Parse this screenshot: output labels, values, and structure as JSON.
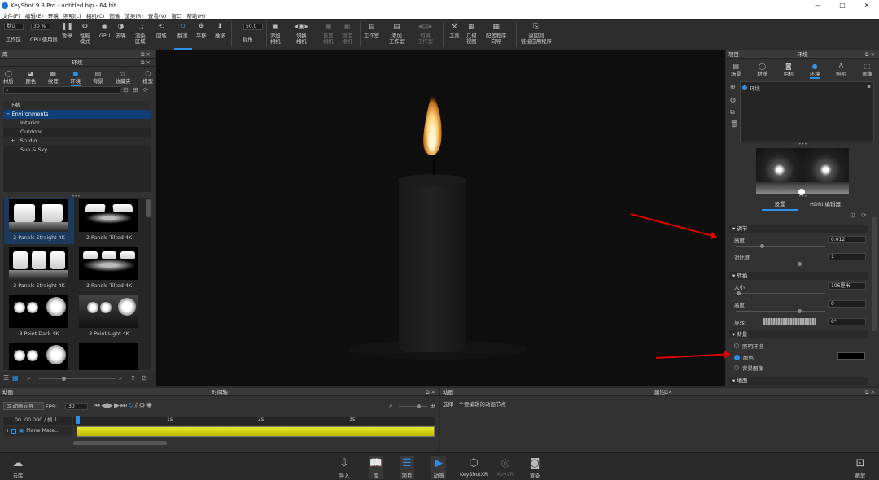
{
  "window": {
    "title": "KeyShot 9.3 Pro  -  untitled.bip  -  64 bit",
    "min": "—",
    "max": "□",
    "close": "✕"
  },
  "menu": [
    "文件(F)",
    "编辑(E)",
    "环境",
    "照明(L)",
    "相机(C)",
    "图像",
    "渲染(R)",
    "查看(V)",
    "窗口",
    "帮助(H)"
  ],
  "toolbar": {
    "workspace_select": "默认",
    "cpu_value": "30 %",
    "workspace": "工作区",
    "cpu_usage": "CPU 使用量",
    "pause": "暂停",
    "perf_mode": [
      "性能",
      "模式"
    ],
    "gpu": "GPU",
    "denoise": "去噪",
    "region": [
      "渲染",
      "区域"
    ],
    "reset": "回城",
    "tumble": "翻滚",
    "pan": "平移",
    "dolly": "推移",
    "fov_value": "50.0",
    "fov": "视角",
    "add_camera": [
      "添加",
      "相机"
    ],
    "switch_camera": [
      "切换",
      "相机"
    ],
    "reset_camera": [
      "重置",
      "相机"
    ],
    "lock_camera": [
      "锁定",
      "相机"
    ],
    "studio": "工作室",
    "add_studio": [
      "添加",
      "工作室"
    ],
    "switch_studio": [
      "切换",
      "工作室"
    ],
    "tools": "工具",
    "geometry_view": [
      "几何",
      "视图"
    ],
    "config_wizard": [
      "配置程序",
      "向导"
    ],
    "back_to_app": [
      "返回到",
      "链接应用程序"
    ]
  },
  "library": {
    "panel_title": "库",
    "section_title": "环境",
    "tabs": [
      "材质",
      "颜色",
      "纹理",
      "环境",
      "背景",
      "收藏夹",
      "模型"
    ],
    "selected_tab": "环境",
    "tree": [
      {
        "label": "下载",
        "indent": 0,
        "prefix": ""
      },
      {
        "label": "Environments",
        "indent": 0,
        "prefix": "−",
        "selected": true
      },
      {
        "label": "Interior",
        "indent": 1,
        "prefix": ""
      },
      {
        "label": "Outdoor",
        "indent": 1,
        "prefix": ""
      },
      {
        "label": "Studio",
        "indent": 1,
        "prefix": "+"
      },
      {
        "label": "Sun & Sky",
        "indent": 1,
        "prefix": ""
      }
    ],
    "thumbs": [
      "2 Panels Straight 4K",
      "2 Panels Tilted 4K",
      "3 Panels Straight 4K",
      "3 Panels Tilted 4K",
      "3 Point Dark 4K",
      "3 Point Light 4K"
    ]
  },
  "project": {
    "panel_title": "项目",
    "section_title": "环境",
    "tabs": [
      "场景",
      "材质",
      "相机",
      "环境",
      "照明",
      "图像"
    ],
    "selected_tab": "环境",
    "env_item": "环境",
    "subtabs": [
      "设置",
      "HDRI 编辑器"
    ],
    "adjust_section": "调节",
    "brightness_label": "亮度",
    "brightness_value": "0.012",
    "contrast_label": "对比度",
    "contrast_value": "1",
    "transform_section": "转换",
    "size_label": "大小",
    "size_value": "106厘米",
    "height_label": "高度",
    "height_value": "0",
    "rotation_label": "旋转:",
    "rotation_value": "0°",
    "background_section": "背景",
    "bg_options": [
      "照明环境",
      "颜色",
      "背景图像"
    ],
    "bg_selected": "颜色",
    "bg_color": "#000000",
    "ground_section": "地面"
  },
  "animation": {
    "panel_title": "动画",
    "timeline_title": "时间轴",
    "wizard_btn": "动画向导",
    "fps_label": "FPS:",
    "fps_value": "30",
    "time": "00 :00.000 / 帧 1",
    "ticks": [
      "1s",
      "2s",
      "3s"
    ],
    "layer": "Plane Mate..."
  },
  "anim_props": {
    "left_title": "动画",
    "right_title": "属性",
    "hint": "选择一个要编辑的动画节点"
  },
  "bottom": {
    "cloud": "云库",
    "import": "导入",
    "library": "库",
    "project": "项目",
    "animation": "动画",
    "keyshotxr": "KeyShotXR",
    "keyvr": "KeyVR",
    "render": "渲染",
    "screenshot": "截屏"
  },
  "colors": {
    "accent": "#2e8fe6",
    "arrow": "#e00000",
    "timeline_bar": "#d8d800"
  }
}
